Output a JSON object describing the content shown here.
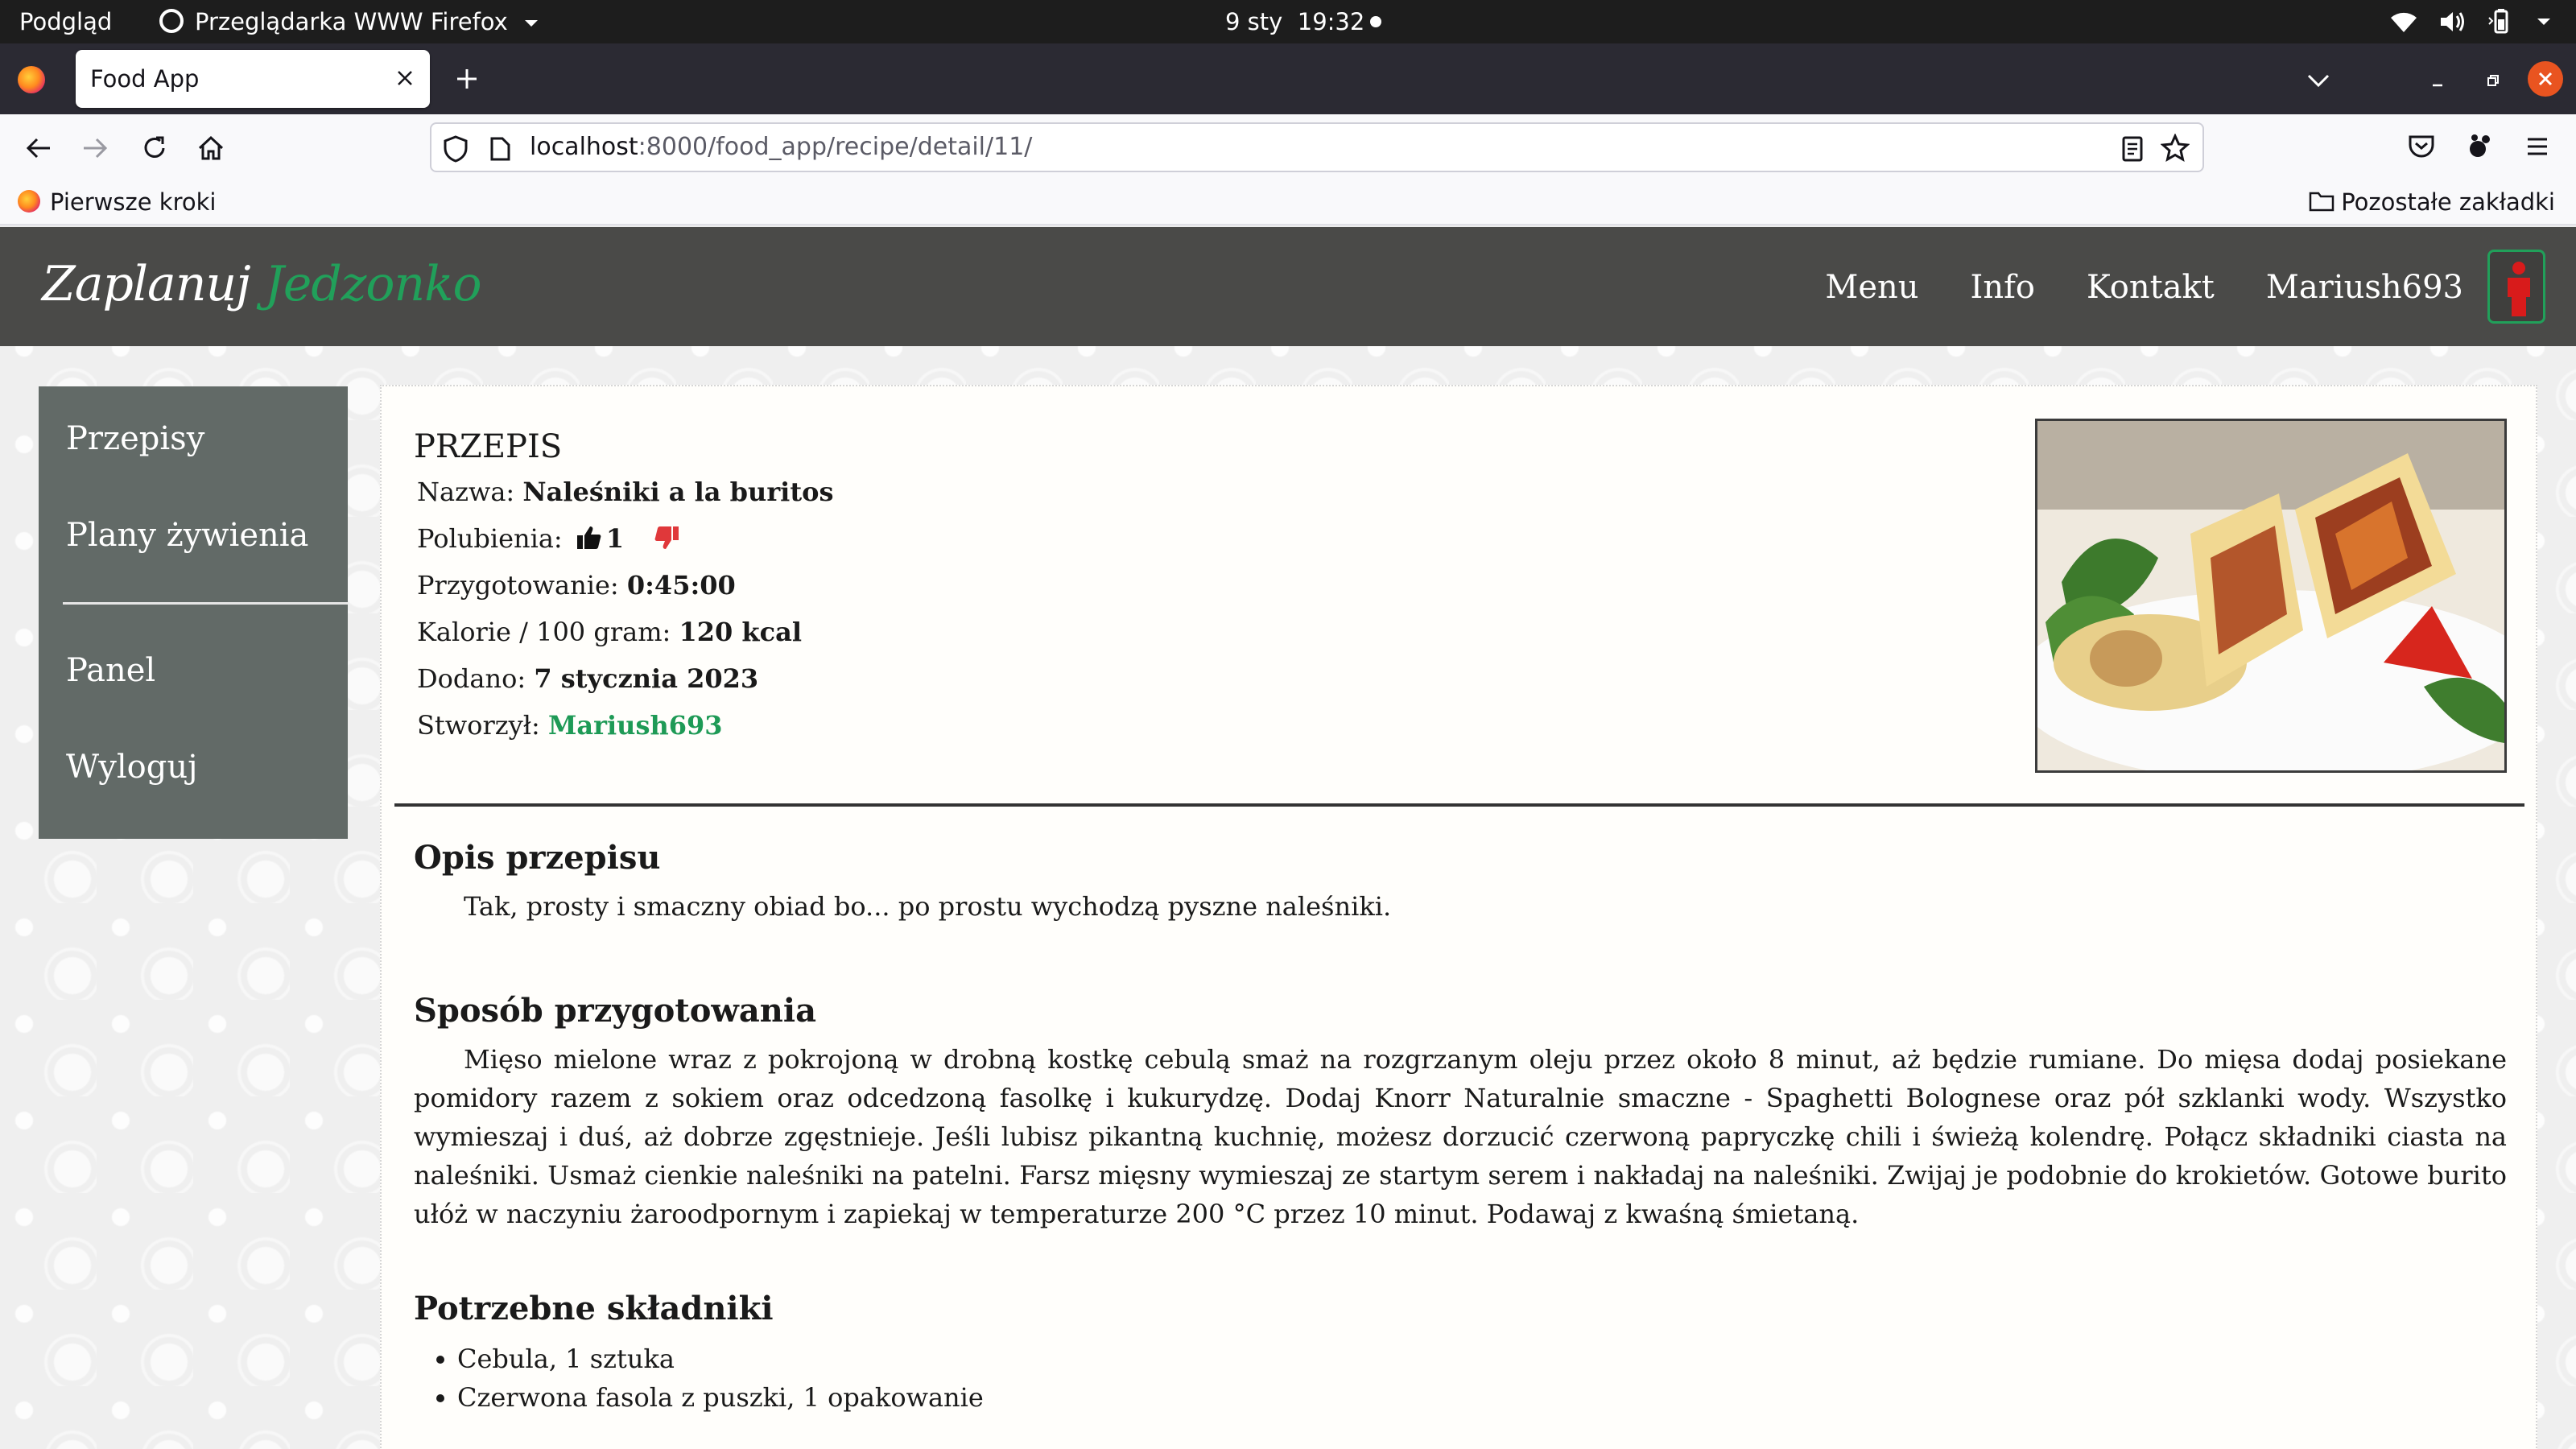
{
  "os_bar": {
    "activities": "Podgląd",
    "app_name": "Przeglądarka WWW Firefox",
    "date": "9 sty",
    "time": "19:32"
  },
  "browser": {
    "tab_title": "Food App",
    "url_host": "localhost",
    "url_rest": ":8000/food_app/recipe/detail/11/",
    "bookmark_left": "Pierwsze kroki",
    "bookmark_right": "Pozostałe zakładki"
  },
  "site": {
    "brand_part1": "Zaplanuj",
    "brand_part2": "Jedzonko",
    "nav": [
      "Menu",
      "Info",
      "Kontakt",
      "Mariush693"
    ],
    "accent_color": "#21a05a",
    "header_color": "#4a4a48"
  },
  "sidebar": {
    "items": [
      "Przepisy",
      "Plany żywienia",
      "Panel",
      "Wyloguj"
    ]
  },
  "recipe": {
    "heading": "PRZEPIS",
    "name_label": "Nazwa:",
    "name": "Naleśniki a la buritos",
    "likes_label": "Polubienia:",
    "likes": "1",
    "prep_label": "Przygotowanie:",
    "prep": "0:45:00",
    "kcal_label": "Kalorie / 100 gram:",
    "kcal": "120 kcal",
    "added_label": "Dodano:",
    "added": "7 stycznia 2023",
    "author_label": "Stworzył:",
    "author": "Mariush693",
    "desc_title": "Opis przepisu",
    "desc": "Tak, prosty i smaczny obiad bo... po prostu wychodzą pyszne naleśniki.",
    "method_title": "Sposób przygotowania",
    "method": "Mięso mielone wraz z pokrojoną w drobną kostkę cebulą smaż na rozgrzanym oleju przez około 8 minut, aż będzie rumiane. Do mięsa dodaj posiekane pomidory razem z sokiem oraz odcedzoną fasolkę i kukurydzę. Dodaj Knorr Naturalnie smaczne - Spaghetti Bolognese oraz pół szklanki wody. Wszystko wymieszaj i duś, aż dobrze zgęstnieje. Jeśli lubisz pikantną kuchnię, możesz dorzucić czerwoną papryczkę chili i świeżą kolendrę. Połącz składniki ciasta na naleśniki. Usmaż cienkie naleśniki na patelni. Farsz mięsny wymieszaj ze startym serem i nakładaj na naleśniki. Zwijaj je podobnie do krokietów. Gotowe burito ułóż w naczyniu żaroodpornym i zapiekaj w temperaturze 200 °C przez 10 minut. Podawaj z kwaśną śmietaną.",
    "ingredients_title": "Potrzebne składniki",
    "ingredients": [
      "Cebula, 1 sztuka",
      "Czerwona fasola z puszki, 1 opakowanie"
    ]
  }
}
